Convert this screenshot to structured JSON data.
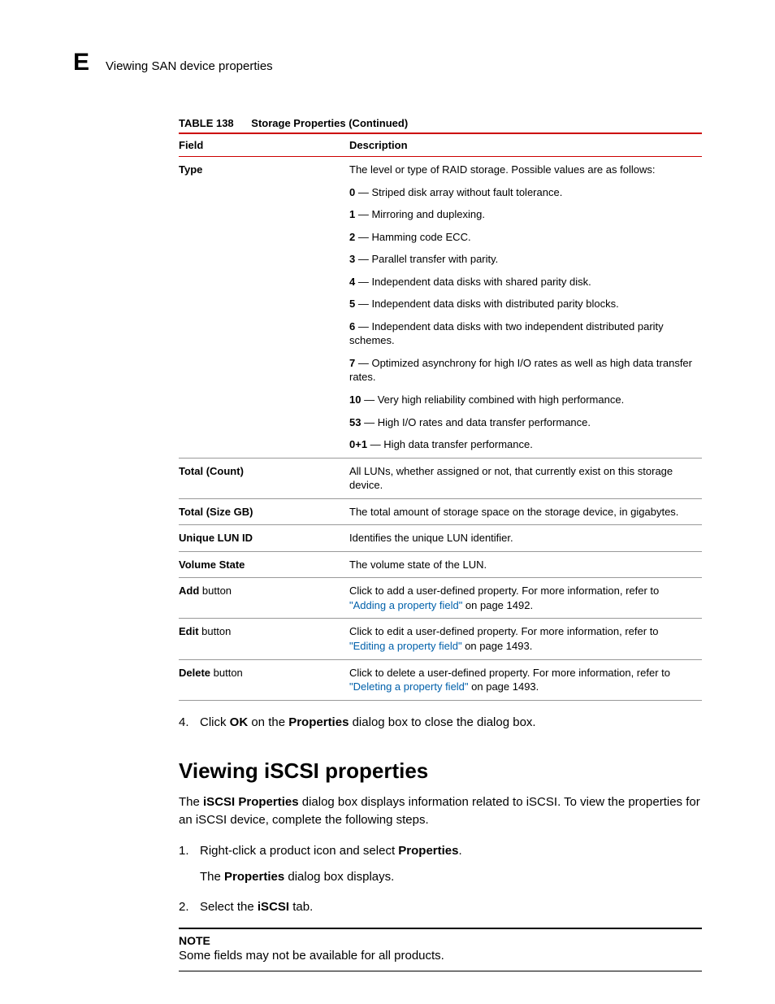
{
  "header": {
    "appendix_letter": "E",
    "breadcrumb": "Viewing SAN device properties"
  },
  "table": {
    "number": "TABLE 138",
    "title": "Storage Properties (Continued)",
    "col_field": "Field",
    "col_desc": "Description",
    "rows": {
      "type": {
        "field": "Type",
        "intro": "The level or type of RAID storage. Possible values are as follows:",
        "items": [
          {
            "code": "0",
            "sep": " — ",
            "text": "Striped disk array without fault tolerance."
          },
          {
            "code": "1",
            "sep": " — ",
            "text": "Mirroring and duplexing."
          },
          {
            "code": "2",
            "sep": " — ",
            "text": "Hamming code ECC."
          },
          {
            "code": "3",
            "sep": " — ",
            "text": "Parallel transfer with parity."
          },
          {
            "code": "4",
            "sep": " — ",
            "text": "Independent data disks with shared parity disk."
          },
          {
            "code": "5",
            "sep": " — ",
            "text": "Independent data disks with distributed parity blocks."
          },
          {
            "code": "6",
            "sep": " — ",
            "text": "Independent data disks with two independent distributed parity schemes."
          },
          {
            "code": "7",
            "sep": " — ",
            "text": "Optimized asynchrony for high I/O rates as well as high data transfer rates."
          },
          {
            "code": "10",
            "sep": " — ",
            "text": "Very high reliability combined with high performance."
          },
          {
            "code": "53",
            "sep": " — ",
            "text": "High I/O rates and data transfer performance."
          },
          {
            "code": "0+1",
            "sep": " — ",
            "text": "High data transfer performance."
          }
        ]
      },
      "total_count": {
        "field": "Total (Count)",
        "desc": "All LUNs, whether assigned or not, that currently exist on this storage device."
      },
      "total_size": {
        "field": "Total (Size GB)",
        "desc": "The total amount of storage space on the storage device, in gigabytes."
      },
      "unique_lun": {
        "field": "Unique LUN ID",
        "desc": "Identifies the unique LUN identifier."
      },
      "volume_state": {
        "field": "Volume State",
        "desc": "The volume state of the LUN."
      },
      "add": {
        "field_bold": "Add",
        "field_rest": " button",
        "desc_pre": "Click to add a user-defined property. For more information, refer to ",
        "link": "\"Adding a property field\"",
        "desc_post": " on page 1492."
      },
      "edit": {
        "field_bold": "Edit",
        "field_rest": " button",
        "desc_pre": "Click to edit a user-defined property. For more information, refer to ",
        "link": "\"Editing a property field\"",
        "desc_post": " on page 1493."
      },
      "delete": {
        "field_bold": "Delete",
        "field_rest": " button",
        "desc_pre": "Click to delete a user-defined property. For more information, refer to ",
        "link": "\"Deleting a property field\"",
        "desc_post": " on page 1493."
      }
    }
  },
  "step4": {
    "num": "4.",
    "pre": "Click ",
    "b1": "OK",
    "mid": " on the ",
    "b2": "Properties",
    "post": " dialog box to close the dialog box."
  },
  "section2": {
    "title": "Viewing iSCSI properties",
    "intro_pre": "The ",
    "intro_b": "iSCSI Properties",
    "intro_post": " dialog box displays information related to iSCSI. To view the properties for an iSCSI device, complete the following steps.",
    "step1": {
      "num": "1.",
      "pre": "Right-click a product icon and select ",
      "b": "Properties",
      "post": ".",
      "sub_pre": "The ",
      "sub_b": "Properties",
      "sub_post": " dialog box displays."
    },
    "step2": {
      "num": "2.",
      "pre": "Select the ",
      "b": "iSCSI",
      "post": " tab."
    },
    "note_label": "NOTE",
    "note_text": "Some fields may not be available for all products."
  }
}
